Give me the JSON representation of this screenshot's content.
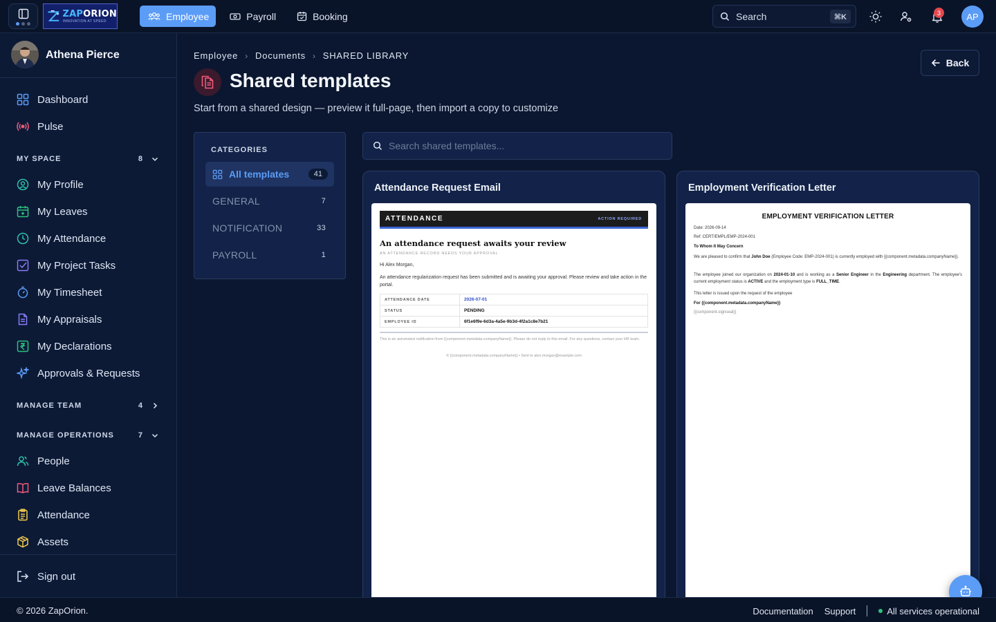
{
  "topbar": {
    "logo": {
      "name_a": "ZAP",
      "name_b": "ORION",
      "tagline": "INNOVATION AT SPEED"
    },
    "nav": [
      {
        "label": "Employee",
        "icon": "people-icon",
        "active": true
      },
      {
        "label": "Payroll",
        "icon": "money-icon",
        "active": false
      },
      {
        "label": "Booking",
        "icon": "calendar-check-icon",
        "active": false
      }
    ],
    "search": {
      "label": "Search",
      "shortcut": "⌘K"
    },
    "notifications_count": "3",
    "user_initials": "AP"
  },
  "sidebar": {
    "user_name": "Athena Pierce",
    "top_items": [
      {
        "label": "Dashboard",
        "icon": "dashboard-icon"
      },
      {
        "label": "Pulse",
        "icon": "broadcast-icon"
      }
    ],
    "my_space": {
      "title": "MY SPACE",
      "count": "8",
      "items": [
        {
          "label": "My Profile",
          "icon": "profile-icon"
        },
        {
          "label": "My Leaves",
          "icon": "calendar-plus-icon"
        },
        {
          "label": "My Attendance",
          "icon": "clock-icon"
        },
        {
          "label": "My Project Tasks",
          "icon": "task-check-icon"
        },
        {
          "label": "My Timesheet",
          "icon": "timer-icon"
        },
        {
          "label": "My Appraisals",
          "icon": "document-icon"
        },
        {
          "label": "My Declarations",
          "icon": "rupee-icon"
        },
        {
          "label": "Approvals & Requests",
          "icon": "sparkle-icon"
        }
      ]
    },
    "manage_team": {
      "title": "MANAGE TEAM",
      "count": "4"
    },
    "manage_operations": {
      "title": "MANAGE OPERATIONS",
      "count": "7",
      "items": [
        {
          "label": "People",
          "icon": "people-icon"
        },
        {
          "label": "Leave Balances",
          "icon": "book-icon"
        },
        {
          "label": "Attendance",
          "icon": "clipboard-icon"
        },
        {
          "label": "Assets",
          "icon": "box-icon"
        }
      ]
    },
    "sign_out": "Sign out"
  },
  "main": {
    "breadcrumb": [
      "Employee",
      "Documents",
      "SHARED LIBRARY"
    ],
    "title": "Shared templates",
    "subtitle": "Start from a shared design — preview it full-page, then import a copy to customize",
    "back_label": "Back",
    "categories": {
      "heading": "CATEGORIES",
      "items": [
        {
          "label": "All templates",
          "count": "41",
          "active": true
        },
        {
          "label": "GENERAL",
          "count": "7",
          "active": false
        },
        {
          "label": "NOTIFICATION",
          "count": "33",
          "active": false
        },
        {
          "label": "PAYROLL",
          "count": "1",
          "active": false
        }
      ]
    },
    "search_placeholder": "Search shared templates...",
    "templates": [
      {
        "title": "Attendance Request Email",
        "preview": {
          "banner_left": "ATTENDANCE",
          "banner_right": "ACTION REQUIRED",
          "heading": "An attendance request awaits your review",
          "subheading": "AN ATTENDANCE RECORD NEEDS YOUR APPROVAL",
          "greeting": "Hi Alex Morgan,",
          "body": "An attendance regularization request has been submitted and is awaiting your approval. Please review and take action in the portal.",
          "rows": [
            {
              "key": "ATTENDANCE DATE",
              "value": "2026-07-01"
            },
            {
              "key": "STATUS",
              "value": "PENDING"
            },
            {
              "key": "EMPLOYEE ID",
              "value": "6f1e6f9e-6d3a-4a5e-9b3d-4f2a1c8e7b21"
            }
          ],
          "footer_note": "This is an automated notification from {{component.metadata.companyName}}. Please do not reply to this email. For any questions, contact your HR team.",
          "footer_copy": "© {{component.metadata.companyName}}  •  Sent to alex.morgan@example.com"
        }
      },
      {
        "title": "Employment Verification Letter",
        "preview": {
          "heading": "EMPLOYMENT VERIFICATION LETTER",
          "date": "Date: 2026-09-14",
          "ref": "Ref: CERT/EMPL/EMP-2024-001",
          "salutation": "To Whom It May Concern",
          "p1_a": "We are pleased to confirm that ",
          "p1_name": "John Doe",
          "p1_b": " (Employee Code: EMP-2024-001) is currently employed with {{component.metadata.companyName}}.",
          "p2_a": "The employee joined our organization on ",
          "p2_date": "2024-01-10",
          "p2_b": " and is working as a ",
          "p2_role": "Senior Engineer",
          "p2_c": " in the ",
          "p2_dept": "Engineering",
          "p2_d": " department. The employee's current employment status is ",
          "p2_status": "ACTIVE",
          "p2_e": " and the employment type is ",
          "p2_type": "FULL_TIME",
          "p2_f": ".",
          "p3": "This letter is issued upon the request of the employee",
          "sign_for": "For {{component.metadata.companyName}}",
          "signseal": "{{component.signseal}}"
        }
      }
    ]
  },
  "footer": {
    "copyright": "© 2026 ZapOrion.",
    "links": [
      "Documentation",
      "Support"
    ],
    "status": "All services operational"
  },
  "colors": {
    "accent": "#5b9cf6",
    "background": "#0b1730",
    "sidebar": "#0c1a36",
    "card": "#122248",
    "status_ok": "#2ec27e",
    "badge": "#e5484d"
  }
}
